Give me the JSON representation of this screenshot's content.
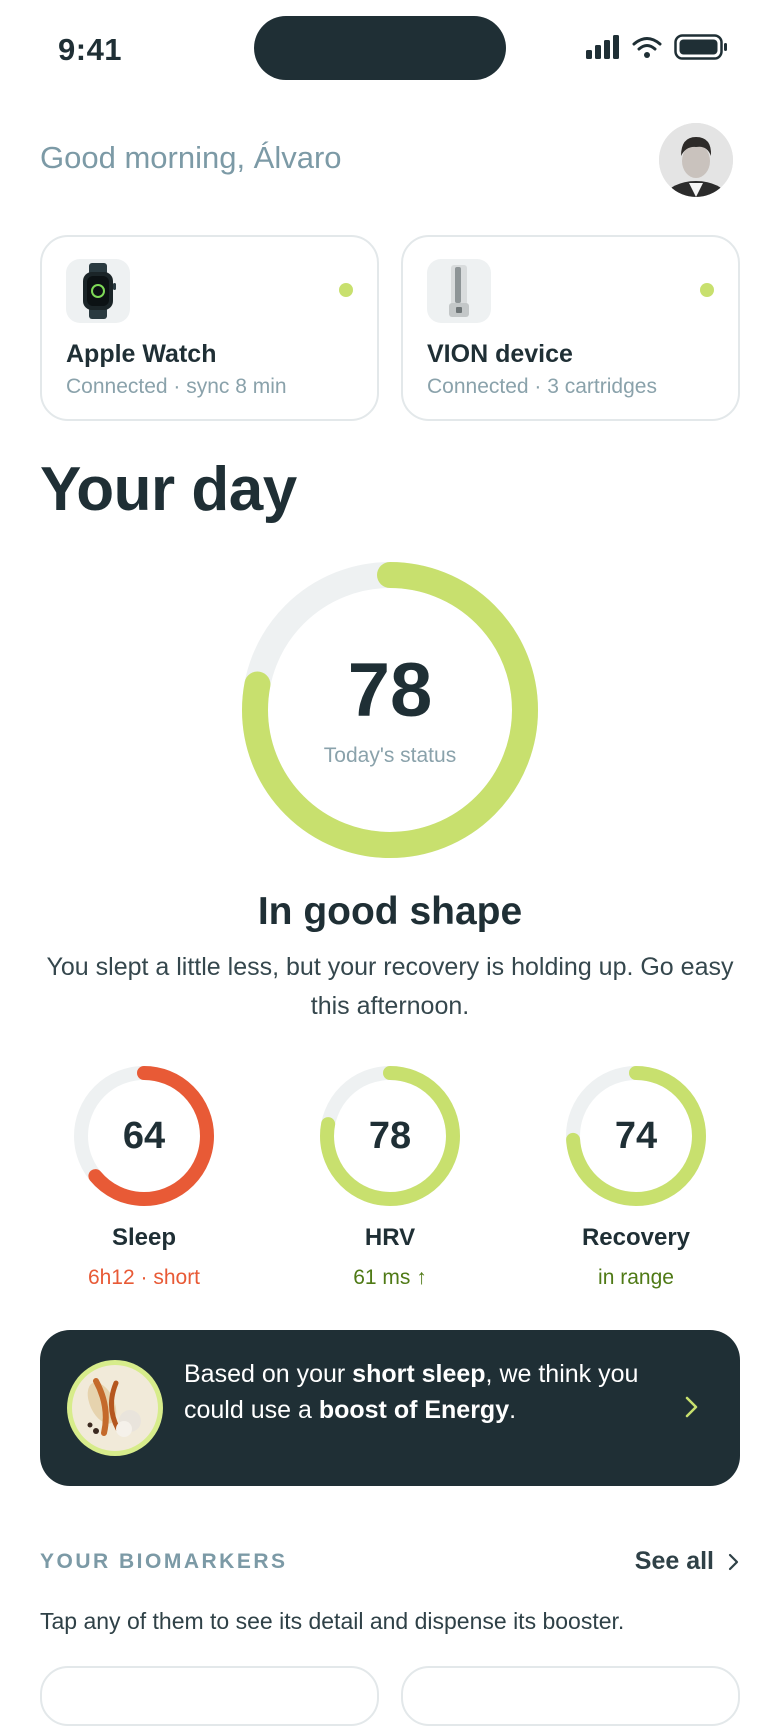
{
  "status_bar": {
    "time": "9:41"
  },
  "header": {
    "greeting": "Good morning, Álvaro"
  },
  "devices": [
    {
      "name": "Apple Watch",
      "status": "Connected · sync 8 min",
      "icon": "watch-icon",
      "connected": true
    },
    {
      "name": "VION device",
      "status": "Connected · 3 cartridges",
      "icon": "dispenser-icon",
      "connected": true
    }
  ],
  "day": {
    "title": "Your day",
    "score": "78",
    "score_value": 78,
    "score_caption": "Today's status",
    "status_title": "In good shape",
    "status_desc": "You slept a little less, but your recovery is holding up. Go easy this afternoon."
  },
  "metrics": [
    {
      "value": "64",
      "progress": 0.64,
      "label": "Sleep",
      "detail": "6h12 · short",
      "color": "#e85a36"
    },
    {
      "value": "78",
      "progress": 0.78,
      "label": "HRV",
      "detail": "61 ms ↑",
      "color": "#c8e06e"
    },
    {
      "value": "74",
      "progress": 0.74,
      "label": "Recovery",
      "detail": "in range",
      "color": "#c8e06e"
    }
  ],
  "recommendation": {
    "part1": "Based on your ",
    "bold1": "short sleep",
    "part2": ", we think you could use a ",
    "bold2": "boost of Energy",
    "part3": "."
  },
  "biomarkers": {
    "heading": "YOUR BIOMARKERS",
    "see_all": "See all",
    "description": "Tap any of them to see its detail and dispense its booster."
  },
  "colors": {
    "accent": "#c8e06e",
    "warning": "#e85a36",
    "dark": "#1f2f35",
    "muted": "#7c9aa6",
    "ring_track": "#eef1f2",
    "positive_text": "#4f7a16"
  }
}
